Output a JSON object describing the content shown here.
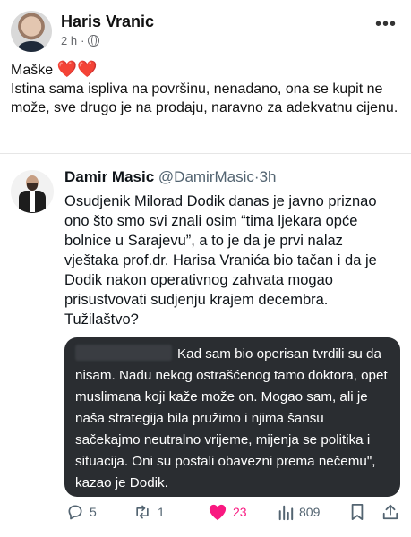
{
  "post": {
    "author": "Haris Vranic",
    "time": "2 h",
    "separator": "·",
    "text_line1": "Maške",
    "hearts": "❤️❤️",
    "text_line2": "Istina sama ispliva na površinu, nenadano, ona se kupit ne može, sve drugo je na prodaju, naravno za adekvatnu cijenu."
  },
  "tweet": {
    "name": "Damir Masic",
    "handle": "@DamirMasic",
    "dot": "·",
    "time": "3h",
    "body": "Osudjenik Milorad Dodik danas je javno priznao ono što smo svi znali osim “tima ljekara opće bolnice u Sarajevu”, a to je da je prvi nalaz vještaka prof.dr. Harisa Vranića bio tačan i da je Dodik nakon operativnog zahvata mogao prisustvovati sudjenju krajem decembra. Tužilaštvo?",
    "quote": "Kad sam bio operisan tvrdili su da nisam. Nađu nekog ostrašćenog tamo doktora, opet muslimana koji kaže može on. Mogao sam, ali je naša strategija bila pružimo i njima šansu sačekajmo neutralno vrijeme, mijenja se politika i situacija. Oni su postali obavezni prema nečemu\", kazao je Dodik."
  },
  "actions": {
    "replies": "5",
    "retweets": "1",
    "likes": "23",
    "views": "809"
  },
  "colors": {
    "like": "#f91880",
    "secondary_text": "#536471",
    "quote_bg": "#2a2d31"
  },
  "icons": [
    "more-icon",
    "globe-icon",
    "reply-icon",
    "retweet-icon",
    "heart-icon",
    "views-icon",
    "bookmark-icon",
    "share-icon"
  ]
}
